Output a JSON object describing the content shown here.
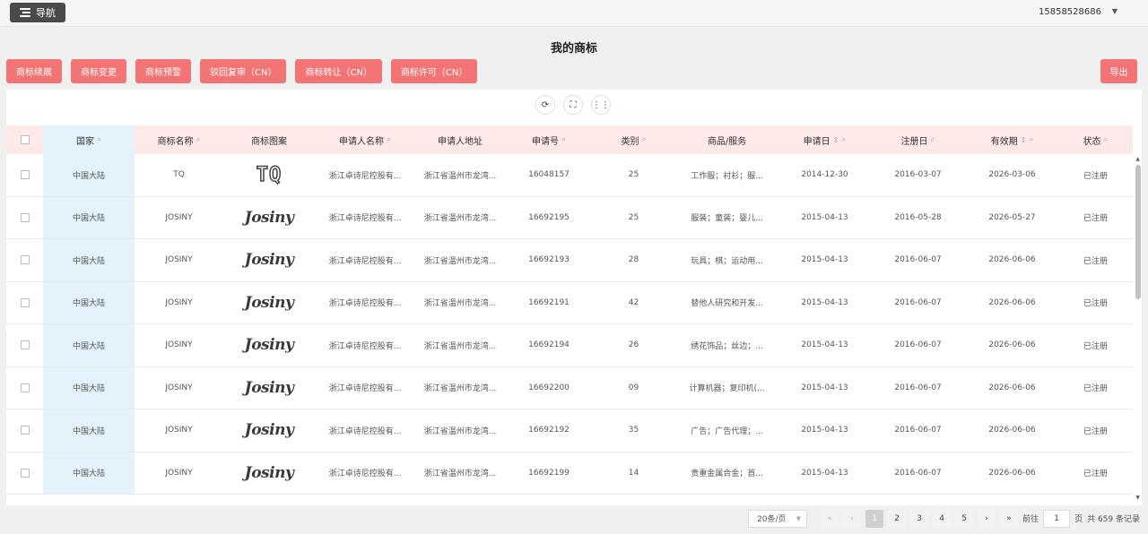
{
  "topbar": {
    "nav_label": "导航",
    "user": "15858528686"
  },
  "page_title": "我的商标",
  "buttons": [
    "商标续展",
    "商标变更",
    "商标预警",
    "驳回复审（CN）",
    "商标转让（CN）",
    "商标许可（CN）"
  ],
  "export_label": "导出",
  "columns": [
    "国家",
    "商标名称",
    "商标图案",
    "申请人名称",
    "申请人地址",
    "申请号",
    "类别",
    "商品/服务",
    "申请日",
    "注册日",
    "有效期",
    "状态"
  ],
  "rows": [
    {
      "country": "中国大陆",
      "name": "TQ",
      "logo": "TQ",
      "applicant": "浙江卓诗尼控股有...",
      "address": "浙江省温州市龙湾...",
      "app_no": "16048157",
      "class": "25",
      "goods": "工作服；衬衫；服...",
      "apply_date": "2014-12-30",
      "reg_date": "2016-03-07",
      "expiry": "2026-03-06",
      "status": "已注册"
    },
    {
      "country": "中国大陆",
      "name": "JOSINY",
      "logo": "Josiny",
      "applicant": "浙江卓诗尼控股有...",
      "address": "浙江省温州市龙湾...",
      "app_no": "16692195",
      "class": "25",
      "goods": "服装；童装；婴儿...",
      "apply_date": "2015-04-13",
      "reg_date": "2016-05-28",
      "expiry": "2026-05-27",
      "status": "已注册"
    },
    {
      "country": "中国大陆",
      "name": "JOSINY",
      "logo": "Josiny",
      "applicant": "浙江卓诗尼控股有...",
      "address": "浙江省温州市龙湾...",
      "app_no": "16692193",
      "class": "28",
      "goods": "玩具；棋；运动用...",
      "apply_date": "2015-04-13",
      "reg_date": "2016-06-07",
      "expiry": "2026-06-06",
      "status": "已注册"
    },
    {
      "country": "中国大陆",
      "name": "JOSINY",
      "logo": "Josiny",
      "applicant": "浙江卓诗尼控股有...",
      "address": "浙江省温州市龙湾...",
      "app_no": "16692191",
      "class": "42",
      "goods": "替他人研究和开发...",
      "apply_date": "2015-04-13",
      "reg_date": "2016-06-07",
      "expiry": "2026-06-06",
      "status": "已注册"
    },
    {
      "country": "中国大陆",
      "name": "JOSINY",
      "logo": "Josiny",
      "applicant": "浙江卓诗尼控股有...",
      "address": "浙江省温州市龙湾...",
      "app_no": "16692194",
      "class": "26",
      "goods": "绣花饰品；丝边；...",
      "apply_date": "2015-04-13",
      "reg_date": "2016-06-07",
      "expiry": "2026-06-06",
      "status": "已注册"
    },
    {
      "country": "中国大陆",
      "name": "JOSINY",
      "logo": "Josiny",
      "applicant": "浙江卓诗尼控股有...",
      "address": "浙江省温州市龙湾...",
      "app_no": "16692200",
      "class": "09",
      "goods": "计算机器；复印机(...",
      "apply_date": "2015-04-13",
      "reg_date": "2016-06-07",
      "expiry": "2026-06-06",
      "status": "已注册"
    },
    {
      "country": "中国大陆",
      "name": "JOSINY",
      "logo": "Josiny",
      "applicant": "浙江卓诗尼控股有...",
      "address": "浙江省温州市龙湾...",
      "app_no": "16692192",
      "class": "35",
      "goods": "广告；广告代理；...",
      "apply_date": "2015-04-13",
      "reg_date": "2016-06-07",
      "expiry": "2026-06-06",
      "status": "已注册"
    },
    {
      "country": "中国大陆",
      "name": "JOSINY",
      "logo": "Josiny",
      "applicant": "浙江卓诗尼控股有...",
      "address": "浙江省温州市龙湾...",
      "app_no": "16692199",
      "class": "14",
      "goods": "贵重金属合金；首...",
      "apply_date": "2015-04-13",
      "reg_date": "2016-06-07",
      "expiry": "2026-06-06",
      "status": "已注册"
    }
  ],
  "pager": {
    "page_size": "20条/页",
    "pages": [
      "1",
      "2",
      "3",
      "4",
      "5"
    ],
    "current": "1",
    "goto_label": "前往",
    "goto_value": "1",
    "page_unit": "页",
    "total": "共 659 条记录"
  },
  "colors": {
    "accent": "#f27474",
    "header_bg": "#fde9e7",
    "country_col_bg": "#e3f2fb"
  }
}
